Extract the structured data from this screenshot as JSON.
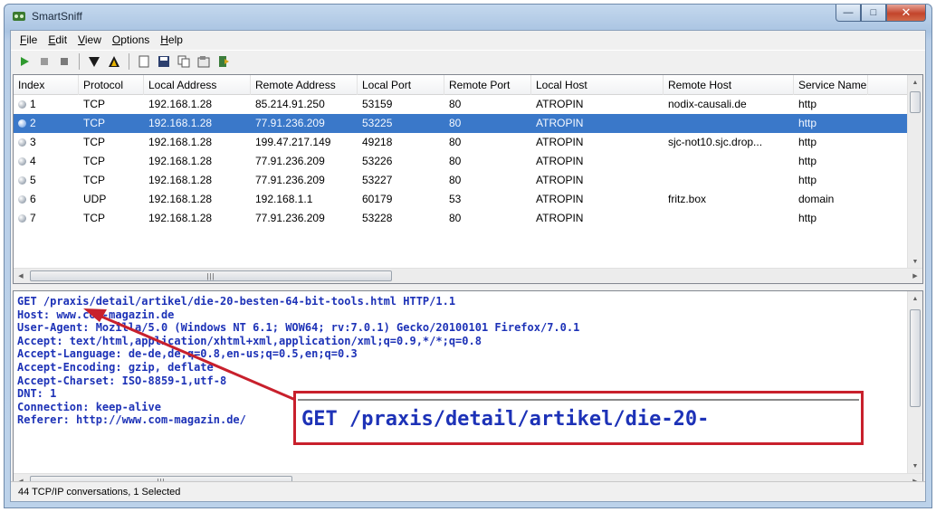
{
  "window": {
    "title": "SmartSniff"
  },
  "menu": [
    {
      "label": "File",
      "key": "F",
      "rest": "ile"
    },
    {
      "label": "Edit",
      "key": "E",
      "rest": "dit"
    },
    {
      "label": "View",
      "key": "V",
      "rest": "iew"
    },
    {
      "label": "Options",
      "key": "O",
      "rest": "ptions"
    },
    {
      "label": "Help",
      "key": "H",
      "rest": "elp"
    }
  ],
  "toolbar": {
    "icons": [
      "start-capture-icon",
      "stop-capture-icon",
      "pause-icon",
      "filter-icon",
      "filter-up-icon",
      "new-icon",
      "save-icon",
      "copy-icon",
      "properties-icon",
      "exit-icon"
    ]
  },
  "table": {
    "headers": [
      "Index",
      "Protocol",
      "Local Address",
      "Remote Address",
      "Local Port",
      "Remote Port",
      "Local Host",
      "Remote Host",
      "Service Name"
    ],
    "rows": [
      [
        "1",
        "TCP",
        "192.168.1.28",
        "85.214.91.250",
        "53159",
        "80",
        "ATROPIN",
        "nodix-causali.de",
        "http"
      ],
      [
        "2",
        "TCP",
        "192.168.1.28",
        "77.91.236.209",
        "53225",
        "80",
        "ATROPIN",
        "",
        "http"
      ],
      [
        "3",
        "TCP",
        "192.168.1.28",
        "199.47.217.149",
        "49218",
        "80",
        "ATROPIN",
        "sjc-not10.sjc.drop...",
        "http"
      ],
      [
        "4",
        "TCP",
        "192.168.1.28",
        "77.91.236.209",
        "53226",
        "80",
        "ATROPIN",
        "",
        "http"
      ],
      [
        "5",
        "TCP",
        "192.168.1.28",
        "77.91.236.209",
        "53227",
        "80",
        "ATROPIN",
        "",
        "http"
      ],
      [
        "6",
        "UDP",
        "192.168.1.28",
        "192.168.1.1",
        "60179",
        "53",
        "ATROPIN",
        "fritz.box",
        "domain"
      ],
      [
        "7",
        "TCP",
        "192.168.1.28",
        "77.91.236.209",
        "53228",
        "80",
        "ATROPIN",
        "",
        "http"
      ]
    ],
    "selected_index": 1
  },
  "content": {
    "lines": [
      "GET /praxis/detail/artikel/die-20-besten-64-bit-tools.html HTTP/1.1",
      "Host: www.com-magazin.de",
      "User-Agent: Mozilla/5.0 (Windows NT 6.1; WOW64; rv:7.0.1) Gecko/20100101 Firefox/7.0.1",
      "Accept: text/html,application/xhtml+xml,application/xml;q=0.9,*/*;q=0.8",
      "Accept-Language: de-de,de;q=0.8,en-us;q=0.5,en;q=0.3",
      "Accept-Encoding: gzip, deflate",
      "Accept-Charset: ISO-8859-1,utf-8",
      "DNT: 1",
      "Connection: keep-alive",
      "Referer: http://www.com-magazin.de/"
    ]
  },
  "callout": {
    "text": "GET /praxis/detail/artikel/die-20-"
  },
  "status": {
    "text": "44 TCP/IP conversations, 1 Selected"
  },
  "colors": {
    "selection": "#3a78c9",
    "text_blue": "#1d32b7",
    "callout_red": "#c8202c"
  }
}
